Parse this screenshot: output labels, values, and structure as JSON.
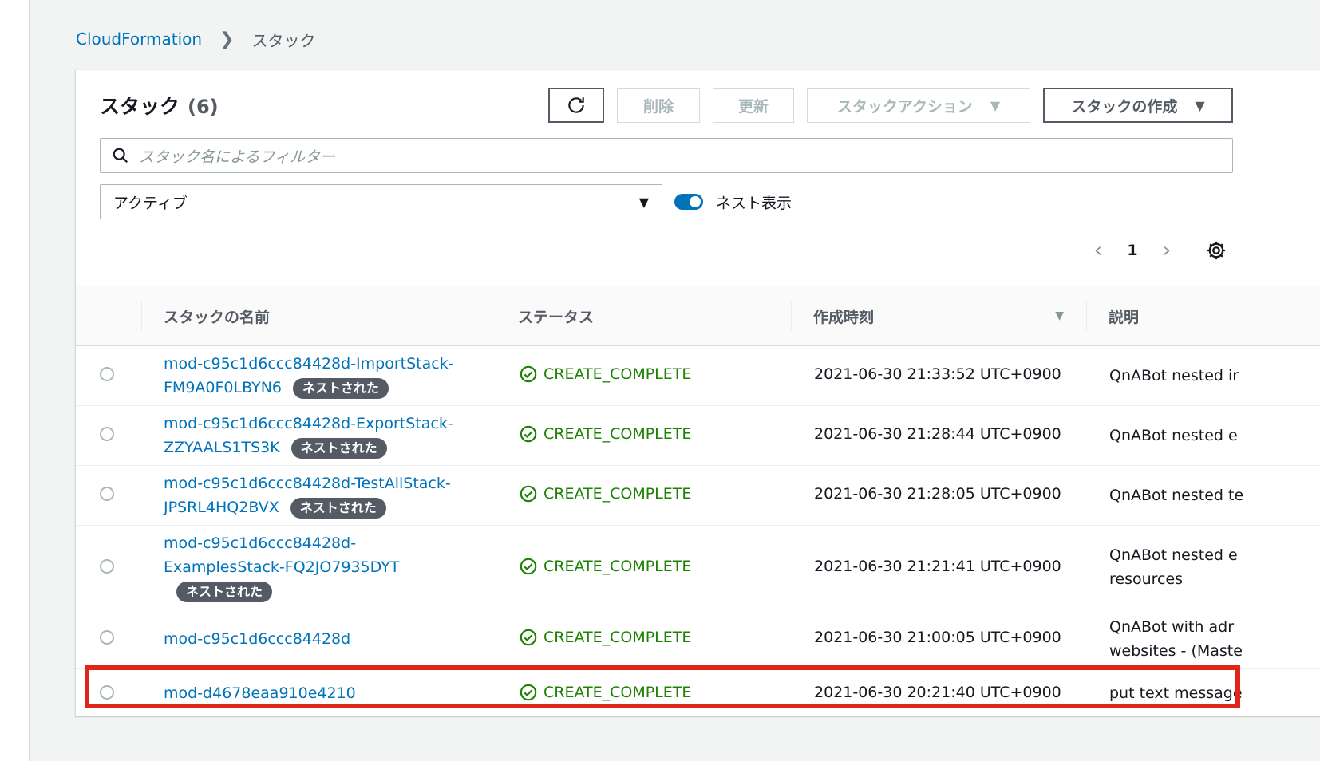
{
  "breadcrumb": {
    "root": "CloudFormation",
    "current": "スタック"
  },
  "panel": {
    "title": "スタック",
    "count": "(6)",
    "buttons": {
      "delete": "削除",
      "update": "更新",
      "actions": "スタックアクション",
      "create": "スタックの作成"
    },
    "search_placeholder": "スタック名によるフィルター",
    "filter_value": "アクティブ",
    "toggle_label": "ネスト表示",
    "toggle_on": true,
    "page": "1"
  },
  "table": {
    "headers": {
      "name": "スタックの名前",
      "status": "ステータス",
      "created": "作成時刻",
      "description": "説明"
    },
    "badge": "ネストされた",
    "rows": [
      {
        "name_line1": "mod-c95c1d6ccc84428d-ImportStack-",
        "name_line2": "FM9A0F0LBYN6",
        "status": "CREATE_COMPLETE",
        "created": "2021-06-30 21:33:52 UTC+0900",
        "desc_line1": "QnABot nested ir",
        "desc_line2": ""
      },
      {
        "name_line1": "mod-c95c1d6ccc84428d-ExportStack-",
        "name_line2": "ZZYAALS1TS3K",
        "status": "CREATE_COMPLETE",
        "created": "2021-06-30 21:28:44 UTC+0900",
        "desc_line1": "QnABot nested e",
        "desc_line2": ""
      },
      {
        "name_line1": "mod-c95c1d6ccc84428d-TestAllStack-",
        "name_line2": "JPSRL4HQ2BVX",
        "status": "CREATE_COMPLETE",
        "created": "2021-06-30 21:28:05 UTC+0900",
        "desc_line1": "QnABot nested te",
        "desc_line2": ""
      },
      {
        "name_line1": "mod-c95c1d6ccc84428d-",
        "name_line2": "ExamplesStack-FQ2JO7935DYT",
        "status": "CREATE_COMPLETE",
        "created": "2021-06-30 21:21:41 UTC+0900",
        "desc_line1": "QnABot nested e",
        "desc_line2": "resources"
      },
      {
        "name_line1": "mod-c95c1d6ccc84428d",
        "name_line2": "",
        "status": "CREATE_COMPLETE",
        "created": "2021-06-30 21:00:05 UTC+0900",
        "desc_line1": "QnABot with adr",
        "desc_line2": "websites - (Maste"
      },
      {
        "name_line1": "mod-d4678eaa910e4210",
        "name_line2": "",
        "status": "CREATE_COMPLETE",
        "created": "2021-06-30 20:21:40 UTC+0900",
        "desc_line1": "put text message",
        "desc_line2": ""
      }
    ]
  },
  "colors": {
    "link": "#0073bb",
    "success": "#1d8102",
    "highlight": "#e0251b"
  }
}
